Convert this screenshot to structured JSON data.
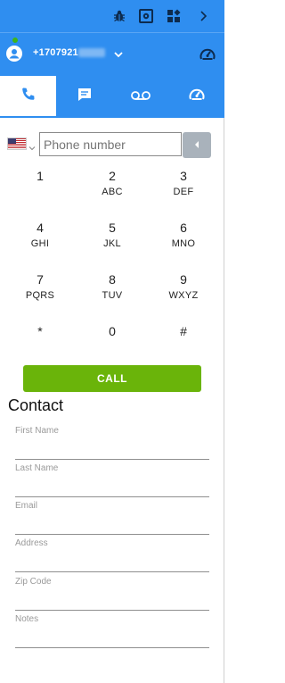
{
  "colors": {
    "primary": "#2f8ef0",
    "call": "#6ab40a",
    "presence": "#3fb618"
  },
  "topbar": {
    "icons": [
      "bug-icon",
      "settings-square-icon",
      "apps-grid-icon",
      "chevron-right-icon"
    ]
  },
  "account": {
    "number": "+1707921",
    "status": "online",
    "icons": [
      "avatar-icon",
      "chevron-down-icon",
      "gauge-icon"
    ]
  },
  "tabs": [
    {
      "name": "phone",
      "icon": "phone-icon",
      "active": true
    },
    {
      "name": "messages",
      "icon": "message-icon",
      "active": false
    },
    {
      "name": "voicemail",
      "icon": "voicemail-icon",
      "active": false
    },
    {
      "name": "dashboard",
      "icon": "gauge-icon",
      "active": false
    }
  ],
  "dialer": {
    "country": "us-flag-icon",
    "input_placeholder": "Phone number",
    "input_value": "",
    "keys": [
      {
        "digit": "1",
        "letters": ""
      },
      {
        "digit": "2",
        "letters": "ABC"
      },
      {
        "digit": "3",
        "letters": "DEF"
      },
      {
        "digit": "4",
        "letters": "GHI"
      },
      {
        "digit": "5",
        "letters": "JKL"
      },
      {
        "digit": "6",
        "letters": "MNO"
      },
      {
        "digit": "7",
        "letters": "PQRS"
      },
      {
        "digit": "8",
        "letters": "TUV"
      },
      {
        "digit": "9",
        "letters": "WXYZ"
      },
      {
        "digit": "*",
        "letters": ""
      },
      {
        "digit": "0",
        "letters": ""
      },
      {
        "digit": "#",
        "letters": ""
      }
    ],
    "call_label": "CALL"
  },
  "contact": {
    "title": "Contact",
    "fields": [
      {
        "label": "First Name",
        "value": ""
      },
      {
        "label": "Last Name",
        "value": ""
      },
      {
        "label": "Email",
        "value": ""
      },
      {
        "label": "Address",
        "value": ""
      },
      {
        "label": "Zip Code",
        "value": ""
      },
      {
        "label": "Notes",
        "value": ""
      }
    ]
  }
}
